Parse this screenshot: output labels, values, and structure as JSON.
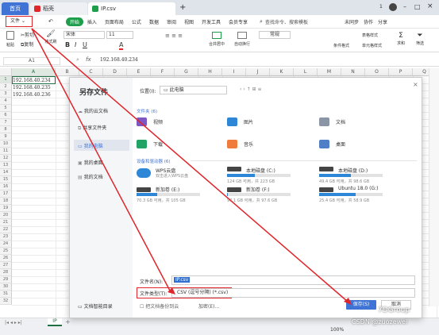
{
  "tabs": {
    "home": "首页",
    "pdf": "稻壳",
    "file": "IP.csv",
    "new": "+"
  },
  "window": {
    "badge": "1"
  },
  "menu": {
    "file": "文件",
    "items": [
      "开始",
      "插入",
      "页面布局",
      "公式",
      "数据",
      "审阅",
      "视图",
      "开发工具",
      "会员专享"
    ],
    "search": "查找命令、搜索模板",
    "sync": "未同步",
    "collab": "协作",
    "share": "分享"
  },
  "ribbon": {
    "cut": "剪切",
    "copy": "复制",
    "paste": "粘贴",
    "format_painter": "格式刷",
    "font_name": "宋体",
    "font_size": "11",
    "number_format": "常规",
    "merge": "合并居中",
    "wrap": "自动换行",
    "cond_format": "条件格式",
    "table_style": "表格样式",
    "cell_style": "单元格样式",
    "sum": "求和",
    "filter": "筛选"
  },
  "formula": {
    "cell_ref": "A1",
    "fx": "fx",
    "value": "192.168.40.234"
  },
  "sheet": {
    "columns": [
      "A",
      "B",
      "C",
      "D",
      "E",
      "F",
      "G",
      "H",
      "I",
      "J",
      "K",
      "L",
      "M",
      "N",
      "O",
      "P",
      "Q"
    ],
    "rows": [
      "1",
      "2",
      "3",
      "4",
      "5",
      "6",
      "7",
      "8",
      "9",
      "10",
      "11",
      "12",
      "13",
      "14",
      "15",
      "16",
      "17",
      "18",
      "19",
      "20",
      "21",
      "22",
      "23",
      "24",
      "25",
      "26",
      "27",
      "28",
      "29",
      "30",
      "31",
      "32"
    ],
    "cells": [
      "192.168.40.234",
      "192.168.40.235",
      "192.168.40.236"
    ]
  },
  "dialog": {
    "title": "另存文件",
    "location_label": "位置(I):",
    "location": "此电脑",
    "sidebar": [
      "我的云文档",
      "共享文件夹",
      "我的电脑",
      "我的桌面",
      "我的文档"
    ],
    "section_folders": "文件夹 (6)",
    "folders": [
      "视频",
      "图片",
      "文档",
      "下载",
      "音乐",
      "桌面"
    ],
    "section_drives": "设备和驱动器 (6)",
    "drives": [
      {
        "name": "WPS云盘",
        "detail": "双击进入WPS云盘",
        "fill": 0
      },
      {
        "name": "本地磁盘 (C:)",
        "detail": "124 GB 可用，共 223 GB",
        "fill": 0.44
      },
      {
        "name": "本地磁盘 (D:)",
        "detail": "49.4 GB 可用，共 98.6 GB",
        "fill": 0.5
      },
      {
        "name": "新加卷 (E:)",
        "detail": "70.3 GB 可用，共 105 GB",
        "fill": 0.33
      },
      {
        "name": "新加卷 (F:)",
        "detail": "97.1 GB 可用，共 97.6 GB",
        "fill": 0.01
      },
      {
        "name": "Ubuntu 18.0 (G:)",
        "detail": "25.4 GB 可用，共 58.9 GB",
        "fill": 0.57
      }
    ],
    "filename_label": "文件名(N):",
    "filename": "IP.csv",
    "filetype_label": "文件类型(T):",
    "filetype": "CSV (逗号分隔) (*.csv)",
    "encrypt_label": "加密(E)...",
    "backup_label": "把文档备份到云",
    "open_dir_label": "文档智能目录",
    "save": "保存(S)",
    "cancel": "取消"
  },
  "statusbar": {
    "sheet": "IP",
    "zoom": "100%"
  },
  "watermark": {
    "site": "CSDN @zuozewei",
    "brand": "7DGroup"
  },
  "colors": {
    "accent": "#3f74d6",
    "highlight_red": "#e0252b",
    "green": "#1e7145"
  }
}
